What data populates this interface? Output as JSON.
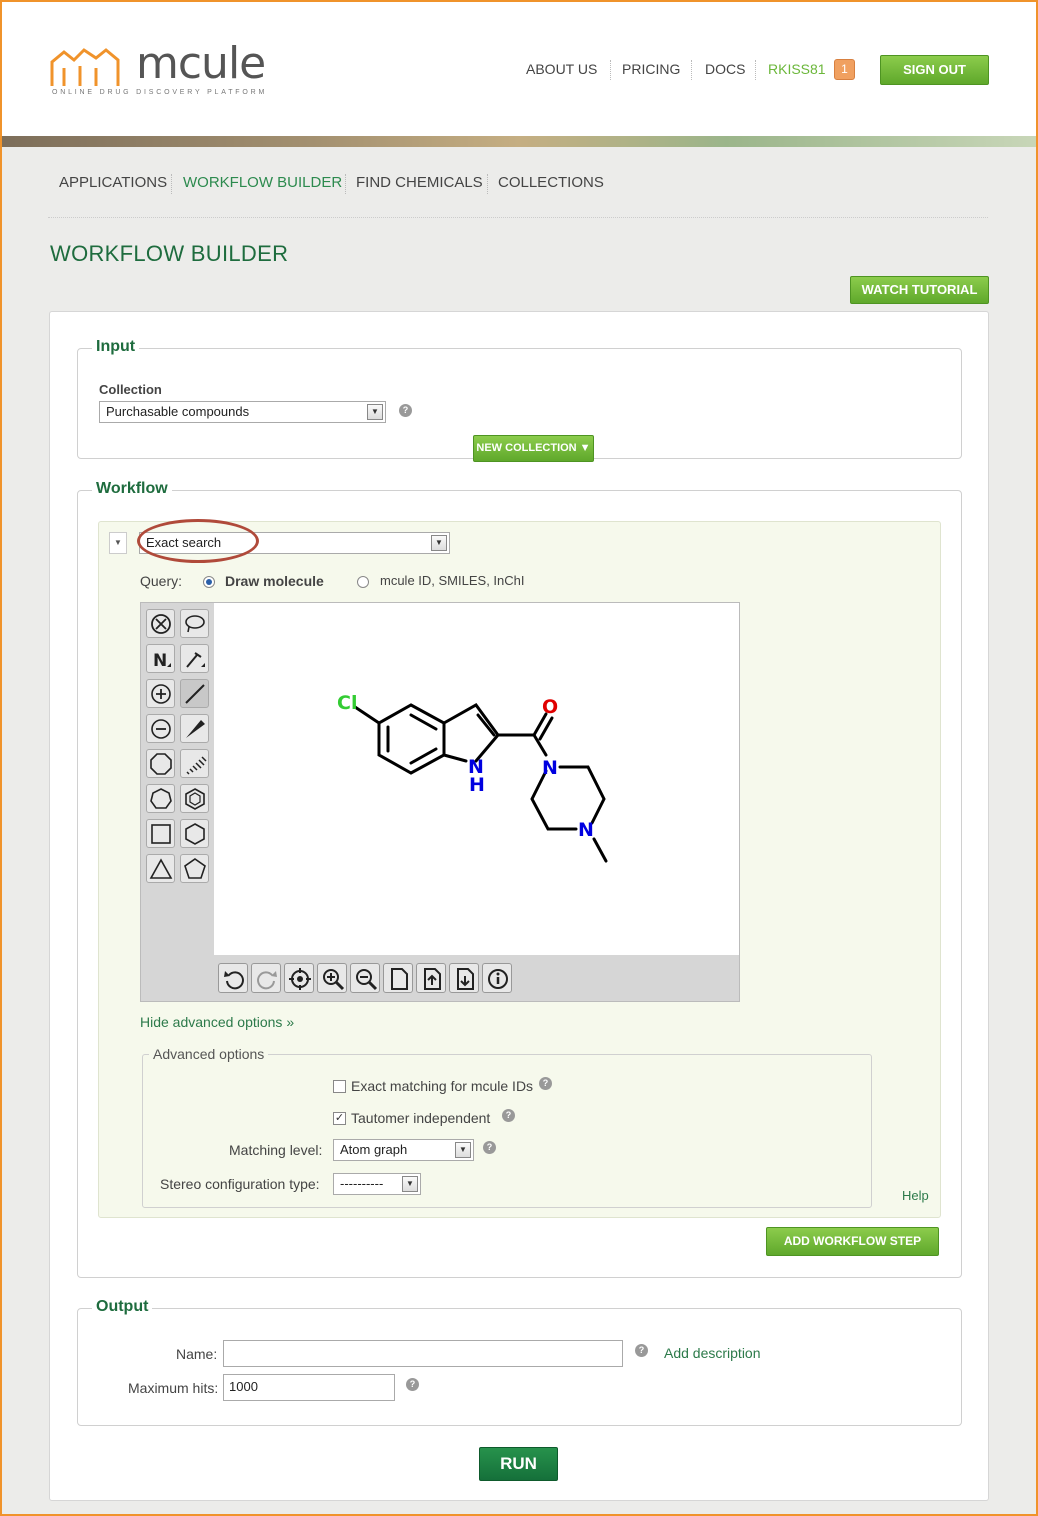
{
  "brand": {
    "word": "mcule",
    "tagline": "ONLINE DRUG DISCOVERY PLATFORM"
  },
  "topnav": {
    "about": "ABOUT US",
    "pricing": "PRICING",
    "docs": "DOCS",
    "user": "RKISS81",
    "badge": "1",
    "signout": "SIGN OUT"
  },
  "mainnav": {
    "applications": "APPLICATIONS",
    "workflow": "WORKFLOW BUILDER",
    "find": "FIND CHEMICALS",
    "collections": "COLLECTIONS"
  },
  "page": {
    "title": "WORKFLOW BUILDER",
    "watch_tutorial": "WATCH TUTORIAL"
  },
  "input": {
    "legend": "Input",
    "collection_label": "Collection",
    "collection_value": "Purchasable compounds",
    "new_collection": "NEW COLLECTION ▼"
  },
  "workflow": {
    "legend": "Workflow",
    "step_type": "Exact search",
    "query_label": "Query:",
    "query_opt1": "Draw molecule",
    "query_opt2": "mcule ID, SMILES, InChI",
    "molecule": {
      "atom_cl": "Cl",
      "atom_o": "O",
      "atom_n1": "N",
      "atom_h": "H",
      "atom_nh": "N",
      "atom_n2": "N",
      "atom_n3": "N"
    },
    "hide_advanced": "Hide advanced options »",
    "advanced": {
      "legend": "Advanced options",
      "exact_matching": "Exact matching for mcule IDs",
      "tautomer": "Tautomer independent",
      "matching_level_label": "Matching level:",
      "matching_level_value": "Atom graph",
      "stereo_label": "Stereo configuration type:",
      "stereo_value": "----------",
      "help": "Help"
    },
    "add_step": "ADD WORKFLOW STEP"
  },
  "output": {
    "legend": "Output",
    "name_label": "Name:",
    "name_value": "",
    "add_description": "Add description",
    "max_hits_label": "Maximum hits:",
    "max_hits_value": "1000"
  },
  "run": "RUN",
  "colors": {
    "brand_green": "#1e6c3e",
    "button_green": "#6bb73a",
    "accent_orange": "#f0932b"
  }
}
